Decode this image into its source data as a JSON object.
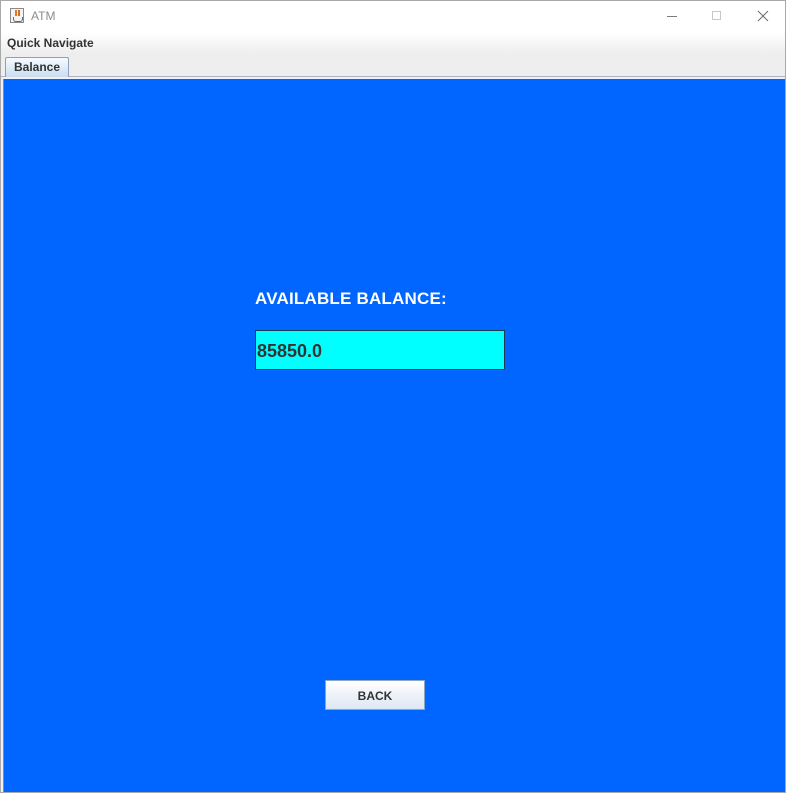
{
  "window": {
    "title": "ATM",
    "icon": "java-cup-icon"
  },
  "menubar": {
    "items": [
      {
        "label": "Quick Navigate"
      }
    ]
  },
  "tabs": [
    {
      "label": "Balance",
      "selected": true
    }
  ],
  "balance_panel": {
    "heading": "AVAILABLE BALANCE:",
    "value": "85850.0",
    "back_button_label": "BACK"
  },
  "colors": {
    "panel_background": "#0066ff",
    "balance_field_background": "#00ffff",
    "heading_text": "#ffffff"
  }
}
